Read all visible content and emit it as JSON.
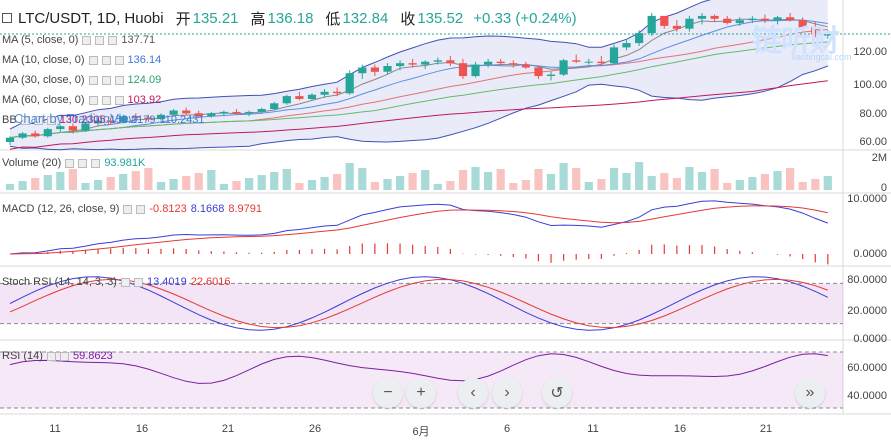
{
  "header": {
    "title": "LTC/USDT, 1D, Huobi",
    "open_label": "开",
    "open": "135.21",
    "high_label": "高",
    "high": "136.18",
    "low_label": "低",
    "low": "132.84",
    "close_label": "收",
    "close": "135.52",
    "change": "+0.33 (+0.24%)"
  },
  "indicators": [
    {
      "name": "MA (5, close, 0)",
      "value": "137.71",
      "color": "#555555"
    },
    {
      "name": "MA (10, close, 0)",
      "value": "136.14",
      "color": "#3c78d8"
    },
    {
      "name": "MA (30, close, 0)",
      "value": "124.09",
      "color": "#29a36a"
    },
    {
      "name": "MA (60, close, 0)",
      "value": "103.92",
      "color": "#c2185b"
    }
  ],
  "bb": {
    "label": "BB",
    "v1": "130.2305",
    "v2": "150.2179",
    "v3": "110.2431"
  },
  "volume": {
    "label": "Volume (20)",
    "value": "93.981K",
    "value_color": "#26a69a"
  },
  "macd": {
    "label": "MACD (12, 26, close, 9)",
    "v1": "-0.8123",
    "v2": "8.1668",
    "v3": "8.9791"
  },
  "stoch": {
    "label": "Stoch RSI (14, 14, 3, 3)",
    "v1": "13.4019",
    "v2": "22.6016"
  },
  "rsi": {
    "label": "RSI (14)",
    "value": "59.8623"
  },
  "price_axis": [
    "120.00",
    "100.00",
    "80.00",
    "60.00"
  ],
  "volume_axis": [
    "2M",
    "0"
  ],
  "macd_axis": [
    "10.0000",
    "0.0000"
  ],
  "stoch_axis": [
    "80.0000",
    "20.0000",
    "0.0000"
  ],
  "rsi_axis": [
    "60.0000",
    "40.0000"
  ],
  "x_ticks": [
    "11",
    "16",
    "21",
    "26",
    "6月",
    "6",
    "11",
    "16",
    "21"
  ],
  "watermark": "链听财",
  "watermark_sub": "liantingcai.com",
  "tv_logo": "Chart by TradingView",
  "nav": {
    "zoom_out": "−",
    "zoom_in": "+",
    "back": "‹",
    "forward": "›",
    "reset": "↺",
    "end": "»"
  },
  "chart_data": {
    "type": "candlestick",
    "candles": [
      [
        60,
        64,
        58,
        63
      ],
      [
        63,
        67,
        62,
        66
      ],
      [
        66,
        68,
        63,
        64
      ],
      [
        64,
        70,
        63,
        69
      ],
      [
        69,
        72,
        67,
        71
      ],
      [
        71,
        73,
        66,
        68
      ],
      [
        68,
        74,
        67,
        73
      ],
      [
        73,
        76,
        71,
        75
      ],
      [
        75,
        77,
        72,
        74
      ],
      [
        74,
        79,
        73,
        78
      ],
      [
        78,
        80,
        75,
        77
      ],
      [
        77,
        79,
        74,
        76
      ],
      [
        76,
        80,
        75,
        79
      ],
      [
        79,
        83,
        78,
        82
      ],
      [
        82,
        84,
        79,
        80
      ],
      [
        80,
        82,
        77,
        78
      ],
      [
        78,
        81,
        77,
        80
      ],
      [
        80,
        82,
        78,
        81
      ],
      [
        81,
        83,
        79,
        80
      ],
      [
        80,
        82,
        78,
        81
      ],
      [
        81,
        84,
        80,
        83
      ],
      [
        83,
        88,
        82,
        87
      ],
      [
        87,
        93,
        86,
        92
      ],
      [
        92,
        95,
        89,
        90
      ],
      [
        90,
        94,
        89,
        93
      ],
      [
        93,
        97,
        91,
        95
      ],
      [
        95,
        98,
        92,
        94
      ],
      [
        94,
        110,
        93,
        108
      ],
      [
        108,
        114,
        104,
        112
      ],
      [
        112,
        114,
        106,
        109
      ],
      [
        109,
        115,
        107,
        113
      ],
      [
        113,
        117,
        110,
        115
      ],
      [
        115,
        118,
        112,
        114
      ],
      [
        114,
        117,
        111,
        116
      ],
      [
        116,
        119,
        114,
        117
      ],
      [
        117,
        120,
        113,
        115
      ],
      [
        115,
        118,
        104,
        106
      ],
      [
        106,
        116,
        105,
        114
      ],
      [
        114,
        118,
        112,
        116
      ],
      [
        116,
        118,
        113,
        115
      ],
      [
        115,
        117,
        112,
        114
      ],
      [
        114,
        116,
        111,
        112
      ],
      [
        112,
        113,
        104,
        106
      ],
      [
        106,
        109,
        103,
        107
      ],
      [
        107,
        118,
        106,
        117
      ],
      [
        117,
        121,
        115,
        116
      ],
      [
        116,
        118,
        114,
        116
      ],
      [
        116,
        120,
        113,
        115
      ],
      [
        115,
        128,
        114,
        126
      ],
      [
        126,
        131,
        124,
        129
      ],
      [
        129,
        138,
        127,
        136
      ],
      [
        136,
        150,
        134,
        148
      ],
      [
        148,
        147,
        139,
        141
      ],
      [
        141,
        145,
        137,
        139
      ],
      [
        139,
        148,
        137,
        146
      ],
      [
        146,
        150,
        142,
        148
      ],
      [
        148,
        149,
        144,
        146
      ],
      [
        146,
        148,
        142,
        143
      ],
      [
        143,
        147,
        141,
        145
      ],
      [
        145,
        148,
        143,
        146
      ],
      [
        146,
        149,
        143,
        145
      ],
      [
        145,
        148,
        142,
        147
      ],
      [
        147,
        150,
        144,
        145
      ],
      [
        145,
        147,
        138,
        140
      ],
      [
        140,
        144,
        133,
        135
      ],
      [
        135,
        138,
        132,
        135
      ]
    ],
    "volume_scale_max": 2000000
  }
}
